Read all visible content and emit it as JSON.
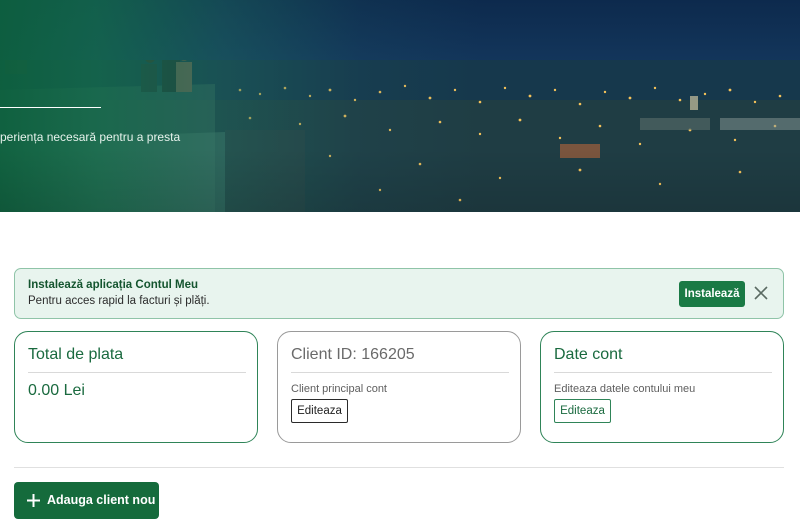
{
  "hero": {
    "subtext": "periența necesară pentru a presta"
  },
  "banner": {
    "title": "Instalează aplicația Contul Meu",
    "subtitle": "Pentru acces rapid la facturi și plăți.",
    "install_label": "Instalează",
    "close_icon": "close-icon"
  },
  "cards": {
    "total": {
      "title": "Total de plata",
      "amount": "0.00 Lei"
    },
    "client": {
      "title": "Client ID: 166205",
      "subtitle": "Client principal cont",
      "edit_label": "Editeaza"
    },
    "account": {
      "title": "Date cont",
      "subtitle": "Editeaza datele contului meu",
      "edit_label": "Editeaza"
    }
  },
  "actions": {
    "add_client_label": "Adauga client nou",
    "add_icon": "plus-icon"
  },
  "colors": {
    "brand_green": "#1a7a45",
    "banner_bg": "#e8f4ee",
    "card_border": "#2f8458"
  }
}
